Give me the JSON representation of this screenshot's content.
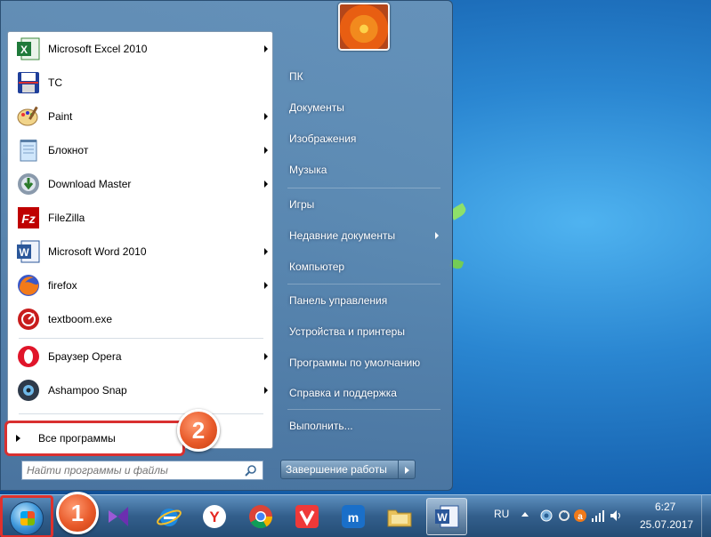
{
  "start_menu": {
    "pinned_apps": [
      {
        "label": "Microsoft Excel 2010",
        "icon": "excel-icon",
        "has_submenu": true
      },
      {
        "label": "TC",
        "icon": "floppy-disk-icon",
        "has_submenu": false
      },
      {
        "label": "Paint",
        "icon": "paint-palette-icon",
        "has_submenu": true
      },
      {
        "label": "Блокнот",
        "icon": "notepad-icon",
        "has_submenu": true
      },
      {
        "label": "Download Master",
        "icon": "download-master-icon",
        "has_submenu": true
      },
      {
        "label": "FileZilla",
        "icon": "filezilla-icon",
        "has_submenu": false
      },
      {
        "label": "Microsoft Word 2010",
        "icon": "word-icon",
        "has_submenu": true
      },
      {
        "label": "firefox",
        "icon": "firefox-icon",
        "has_submenu": true
      },
      {
        "label": "textboom.exe",
        "icon": "textboom-icon",
        "has_submenu": false
      },
      {
        "label": "Браузер Opera",
        "icon": "opera-icon",
        "has_submenu": true
      },
      {
        "label": "Ashampoo Snap",
        "icon": "ashampoo-snap-icon",
        "has_submenu": true
      }
    ],
    "all_programs_label": "Все программы",
    "search_placeholder": "Найти программы и файлы",
    "right_items": [
      {
        "label": "ПК"
      },
      {
        "label": "Документы"
      },
      {
        "label": "Изображения"
      },
      {
        "label": "Музыка"
      },
      {
        "label": "Игры"
      },
      {
        "label": "Недавние документы",
        "has_submenu": true
      },
      {
        "label": "Компьютер"
      },
      {
        "label": "Панель управления"
      },
      {
        "label": "Устройства и принтеры"
      },
      {
        "label": "Программы по умолчанию"
      },
      {
        "label": "Справка и поддержка"
      },
      {
        "label": "Выполнить..."
      }
    ],
    "shutdown_label": "Завершение работы"
  },
  "annotations": {
    "badge_1": "1",
    "badge_2": "2"
  },
  "taskbar": {
    "apps": [
      "visual-studio-icon",
      "internet-explorer-icon",
      "yandex-browser-icon",
      "chrome-icon",
      "vivaldi-icon",
      "maxthon-icon",
      "file-explorer-icon",
      "word-icon"
    ],
    "language": "RU",
    "time": "6:27",
    "date": "25.07.2017"
  },
  "colors": {
    "badge": "#e85a2a",
    "highlight_border": "#d93030"
  }
}
